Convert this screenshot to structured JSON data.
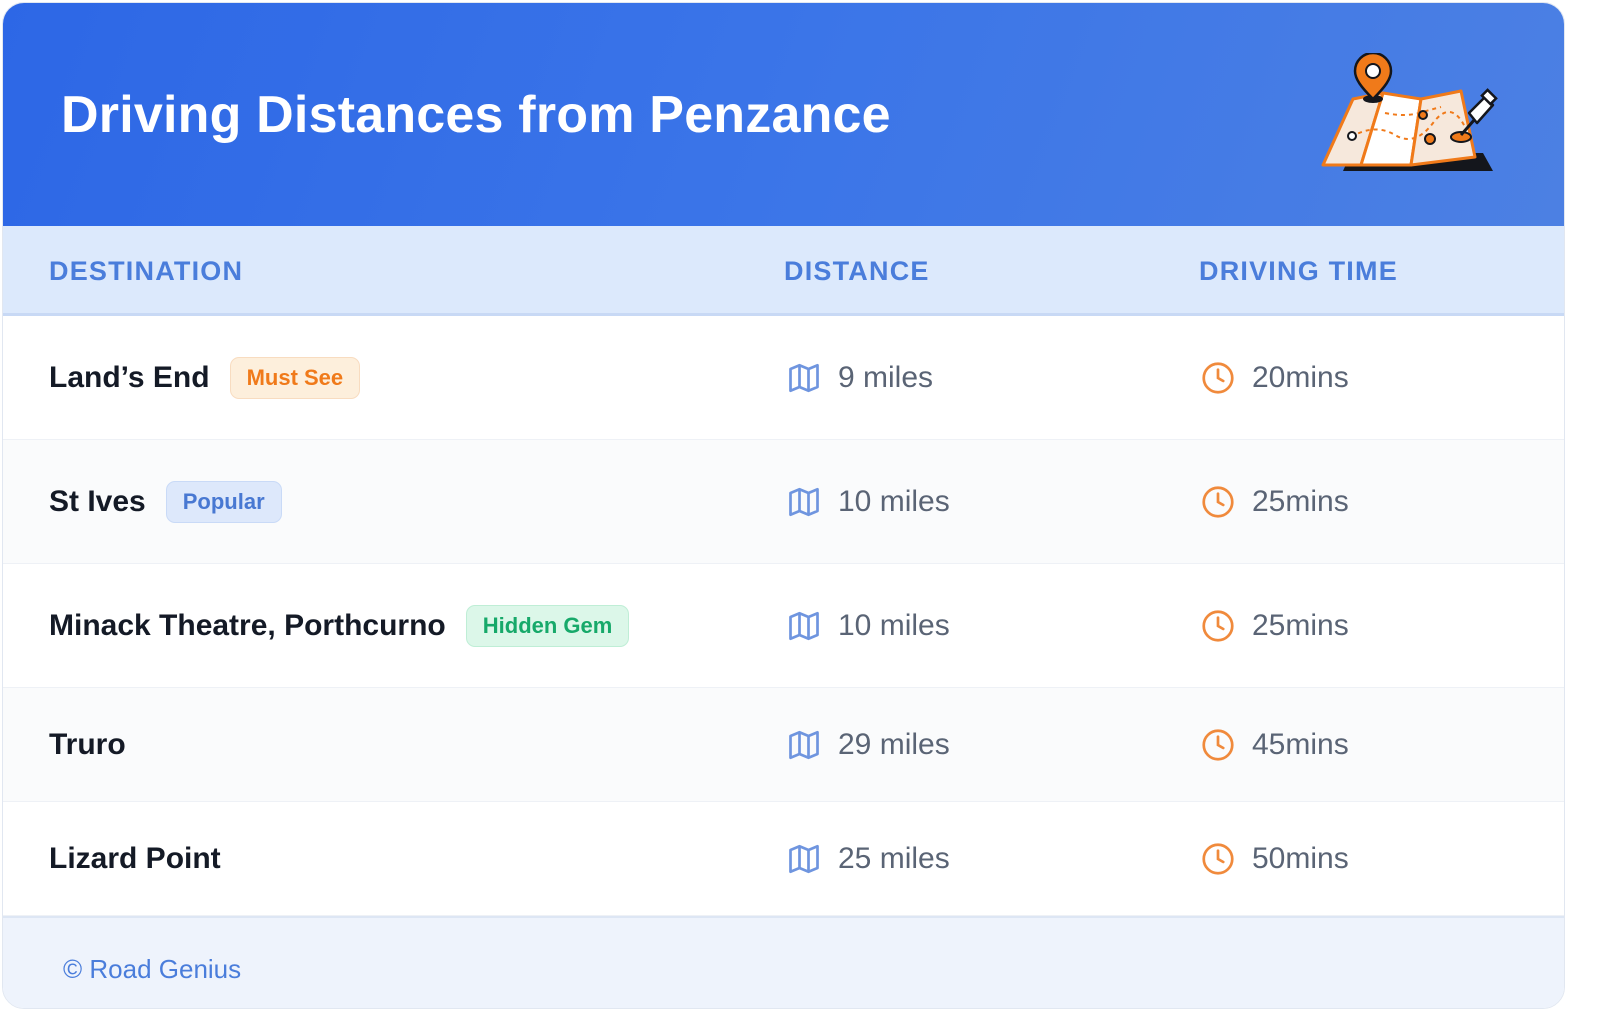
{
  "header": {
    "title": "Driving Distances from Penzance",
    "illustration_icon": "folded-map-with-pins-icon"
  },
  "table": {
    "columns": [
      "DESTINATION",
      "DISTANCE",
      "DRIVING TIME"
    ],
    "rows": [
      {
        "destination": "Land’s End",
        "badge": "Must See",
        "badge_color": "#f07a1a",
        "distance": "9 miles",
        "time": "20mins"
      },
      {
        "destination": "St Ives",
        "badge": "Popular",
        "badge_color": "#4878d2",
        "distance": "10 miles",
        "time": "25mins"
      },
      {
        "destination": "Minack Theatre, Porthcurno",
        "badge": "Hidden Gem",
        "badge_color": "#17a96a",
        "distance": "10 miles",
        "time": "25mins"
      },
      {
        "destination": "Truro",
        "badge": "",
        "distance": "29 miles",
        "time": "45mins"
      },
      {
        "destination": "Lizard Point",
        "badge": "",
        "distance": "25 miles",
        "time": "50mins"
      }
    ],
    "distance_icon": "map-icon",
    "time_icon": "clock-icon"
  },
  "footer": {
    "text": "© Road Genius"
  },
  "colors": {
    "header_bg": "#2d67e6",
    "accent": "#4a7ddb",
    "clock": "#f08a3c"
  }
}
